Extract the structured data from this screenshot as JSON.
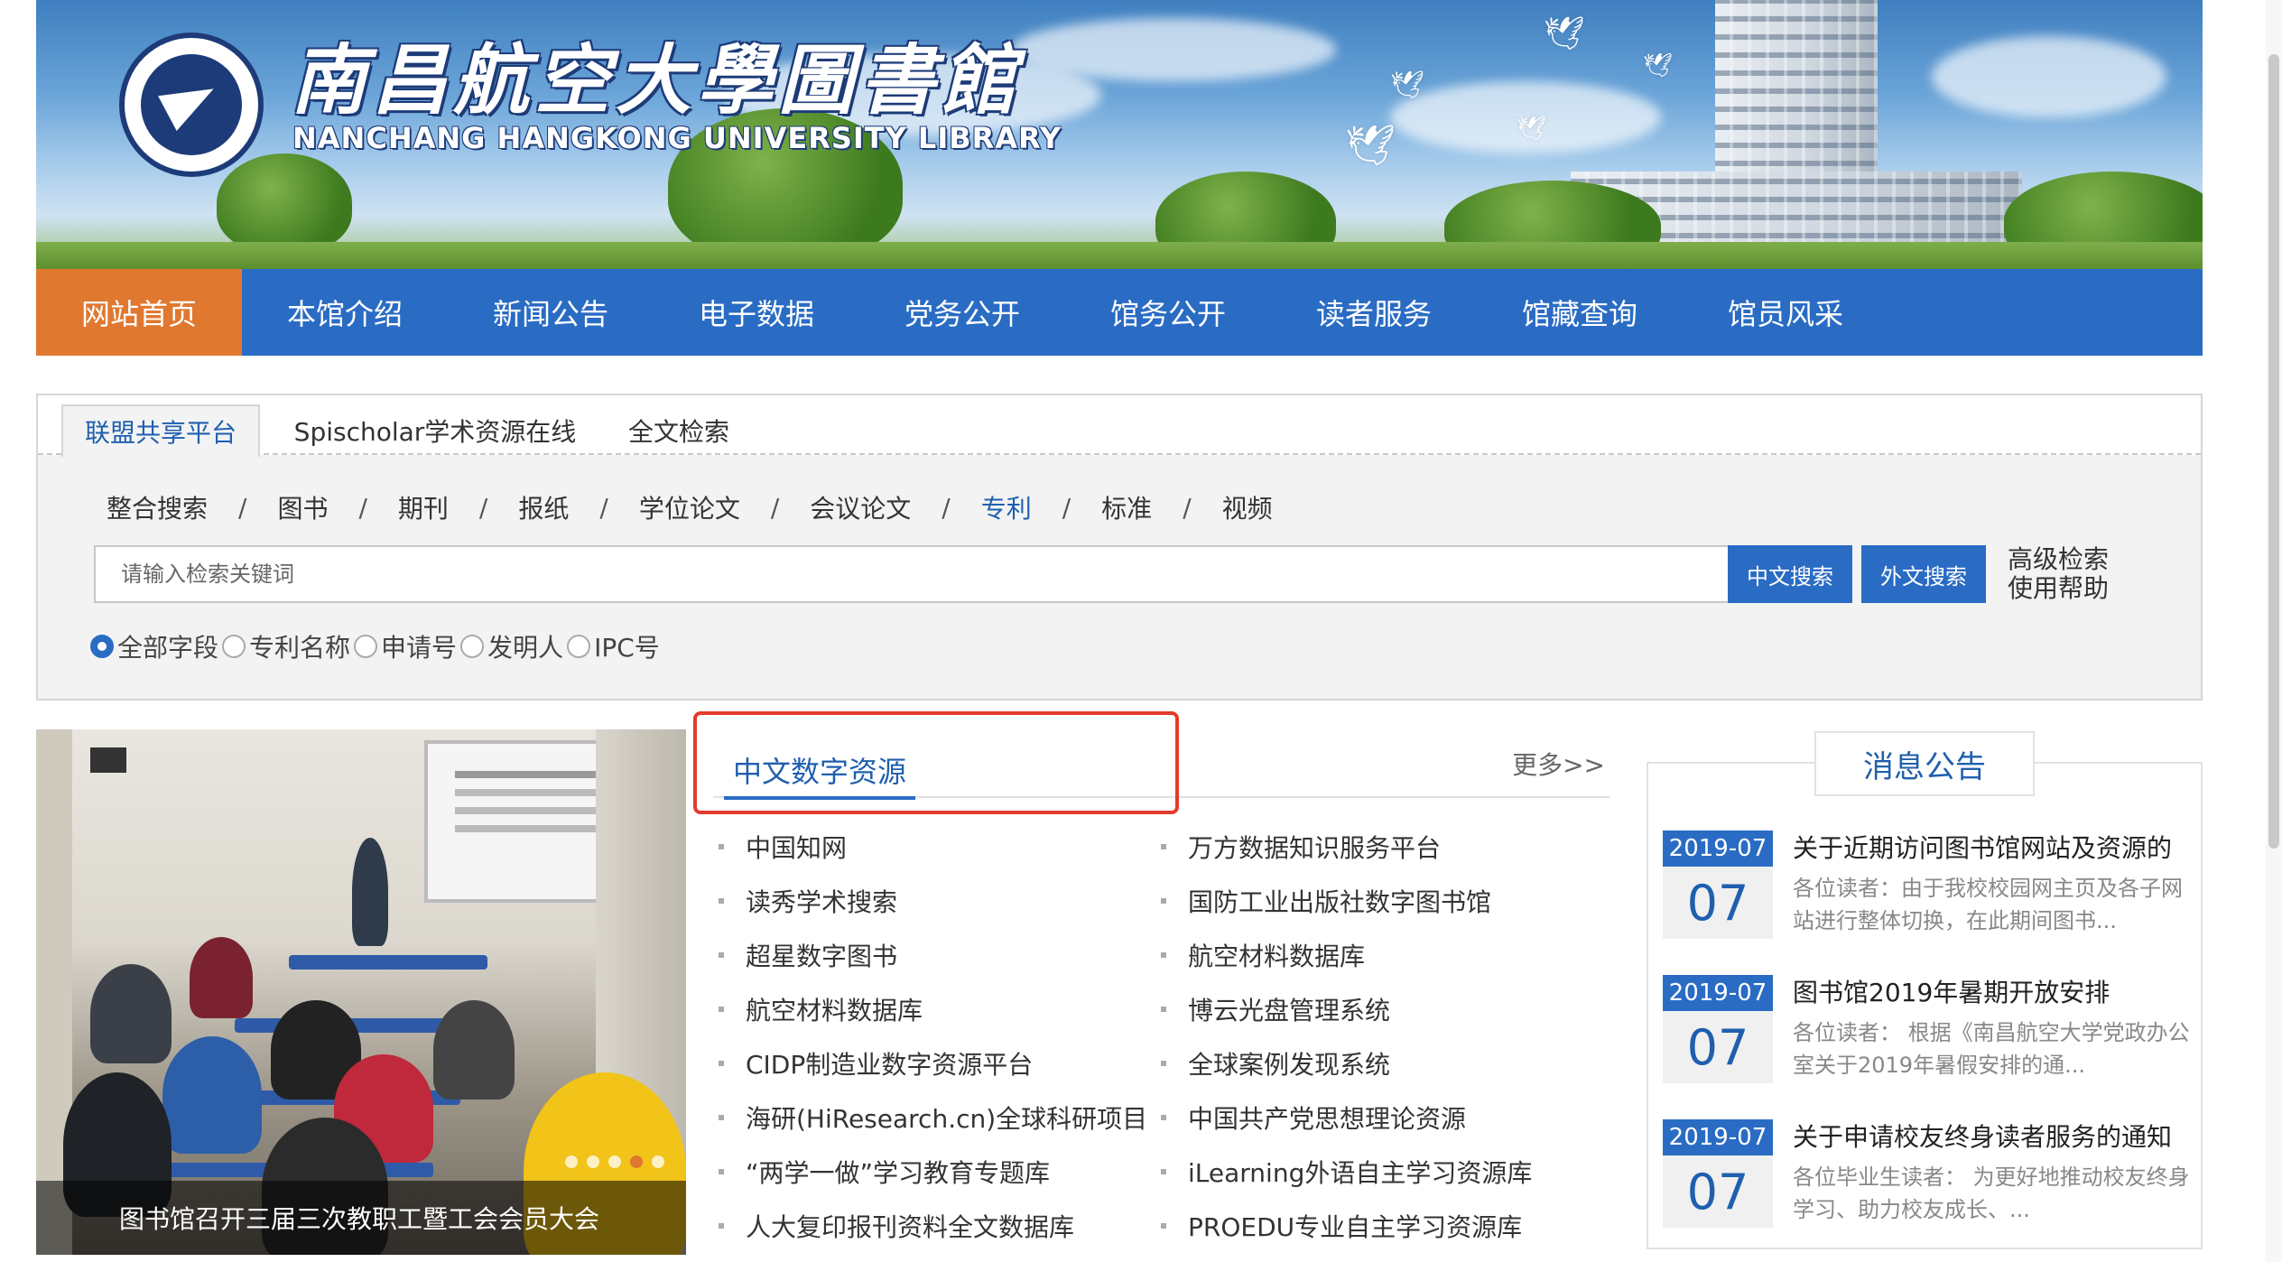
{
  "header": {
    "title_cn": "南昌航空大學圖書館",
    "title_en": "NANCHANG HANGKONG UNIVERSITY LIBRARY"
  },
  "nav": {
    "items": [
      {
        "label": "网站首页",
        "active": true
      },
      {
        "label": "本馆介绍"
      },
      {
        "label": "新闻公告"
      },
      {
        "label": "电子数据"
      },
      {
        "label": "党务公开"
      },
      {
        "label": "馆务公开"
      },
      {
        "label": "读者服务"
      },
      {
        "label": "馆藏查询"
      },
      {
        "label": "馆员风采"
      }
    ]
  },
  "search": {
    "tabs": [
      "联盟共享平台",
      "Spischolar学术资源在线",
      "全文检索"
    ],
    "categories": [
      "整合搜索",
      "图书",
      "期刊",
      "报纸",
      "学位论文",
      "会议论文",
      "专利",
      "标准",
      "视频"
    ],
    "separator": "/",
    "placeholder": "请输入检索关键词",
    "btn_cn": "中文搜索",
    "btn_en": "外文搜索",
    "advanced": "高级检索",
    "help": "使用帮助",
    "fields": [
      "全部字段",
      "专利名称",
      "申请号",
      "发明人",
      "IPC号"
    ]
  },
  "slideshow": {
    "caption": "图书馆召开三届三次教职工暨工会会员大会",
    "dot_count": 5,
    "active_dot": 4
  },
  "resources": {
    "title": "中文数字资源",
    "more": "更多>>",
    "col1": [
      "中国知网",
      "读秀学术搜索",
      "超星数字图书",
      "航空材料数据库",
      "CIDP制造业数字资源平台",
      "海研(HiResearch.cn)全球科研项目",
      "“两学一做”学习教育专题库",
      "人大复印报刊资料全文数据库"
    ],
    "col2": [
      "万方数据知识服务平台",
      "国防工业出版社数字图书馆",
      "航空材料数据库",
      "博云光盘管理系统",
      "全球案例发现系统",
      "中国共产党思想理论资源",
      "iLearning外语自主学习资源库",
      "PROEDU专业自主学习资源库"
    ]
  },
  "notices": {
    "title": "消息公告",
    "items": [
      {
        "ym": "2019-07",
        "day": "07",
        "title": "关于近期访问图书馆网站及资源的",
        "summary": "各位读者：由于我校校园网主页及各子网站进行整体切换，在此期间图书..."
      },
      {
        "ym": "2019-07",
        "day": "07",
        "title": "图书馆2019年暑期开放安排",
        "summary": "各位读者：  根据《南昌航空大学党政办公室关于2019年暑假安排的通..."
      },
      {
        "ym": "2019-07",
        "day": "07",
        "title": "关于申请校友终身读者服务的通知",
        "summary": "各位毕业生读者：    为更好地推动校友终身学习、助力校友成长、..."
      }
    ]
  }
}
